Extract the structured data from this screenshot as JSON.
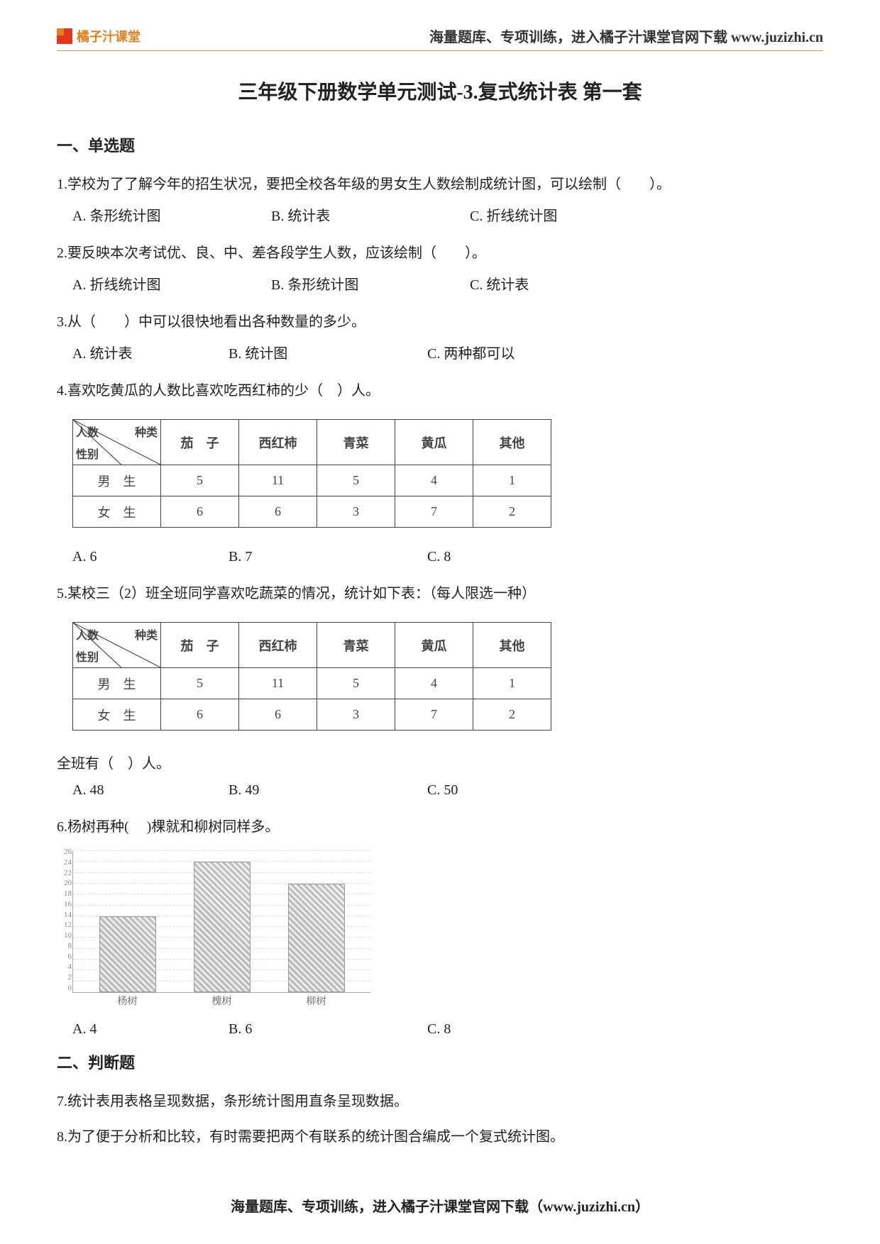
{
  "header": {
    "logo_text": "橘子汁课堂",
    "note_prefix": "海量题库、专项训练，进入橘子汁课堂官网下载 ",
    "note_link": "www.juzizhi.cn"
  },
  "title": "三年级下册数学单元测试-3.复式统计表  第一套",
  "sections": {
    "s1": "一、单选题",
    "s2": "二、判断题"
  },
  "q1": {
    "stem": "1.学校为了了解今年的招生状况，要把全校各年级的男女生人数绘制成统计图，可以绘制（　　）。",
    "A": "A. 条形统计图",
    "B": "B. 统计表",
    "C": "C. 折线统计图"
  },
  "q2": {
    "stem": "2.要反映本次考试优、良、中、差各段学生人数，应该绘制（　　）。",
    "A": "A. 折线统计图",
    "B": "B. 条形统计图",
    "C": "C. 统计表"
  },
  "q3": {
    "stem": "3.从（　　）中可以很快地看出各种数量的多少。",
    "A": "A. 统计表",
    "B": "B. 统计图",
    "C": "C. 两种都可以"
  },
  "q4": {
    "stem": "4.喜欢吃黄瓜的人数比喜欢吃西红柿的少（　）人。",
    "A": "A. 6",
    "B": "B. 7",
    "C": "C. 8"
  },
  "q5": {
    "stem": "5.某校三（2）班全班同学喜欢吃蔬菜的情况，统计如下表：（每人限选一种）",
    "sub": "全班有（　）人。",
    "A": "A. 48",
    "B": "B. 49",
    "C": "C. 50"
  },
  "q6": {
    "stem": "6.杨树再种(　 )棵就和柳树同样多。",
    "A": "A. 4",
    "B": "B. 6",
    "C": "C. 8"
  },
  "q7": {
    "stem": "7.统计表用表格呈现数据，条形统计图用直条呈现数据。"
  },
  "q8": {
    "stem": "8.为了便于分析和比较，有时需要把两个有联系的统计图合编成一个复式统计图。"
  },
  "table": {
    "diag_top": "种类",
    "diag_left": "人数",
    "diag_bot": "性别",
    "cols": [
      "茄　子",
      "西红柿",
      "青菜",
      "黄瓜",
      "其他"
    ],
    "rows": [
      {
        "label": "男　生",
        "vals": [
          "5",
          "11",
          "5",
          "4",
          "1"
        ]
      },
      {
        "label": "女　生",
        "vals": [
          "6",
          "6",
          "3",
          "7",
          "2"
        ]
      }
    ]
  },
  "chart_data": {
    "type": "bar",
    "categories": [
      "杨树",
      "槐树",
      "柳树"
    ],
    "values": [
      14,
      24,
      20
    ],
    "title": "",
    "xlabel": "",
    "ylabel": "",
    "ylim": [
      0,
      26
    ],
    "yticks": [
      0,
      2,
      4,
      6,
      8,
      10,
      12,
      14,
      16,
      18,
      20,
      22,
      24,
      26
    ]
  },
  "footer": "海量题库、专项训练，进入橘子汁课堂官网下载（www.juzizhi.cn）"
}
